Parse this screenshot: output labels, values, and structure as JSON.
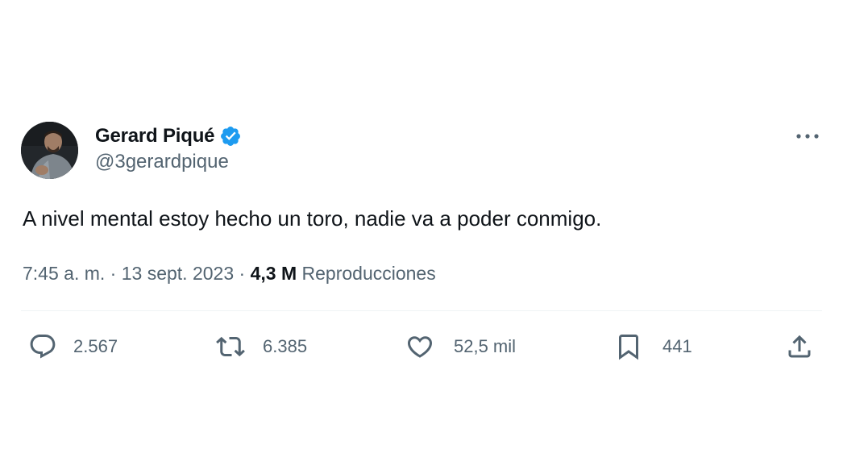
{
  "tweet": {
    "author": {
      "display_name": "Gerard Piqué",
      "handle": "@3gerardpique",
      "verified": true
    },
    "text": "A nivel mental estoy hecho un toro, nadie va a poder conmigo.",
    "meta": {
      "time": "7:45 a. m.",
      "separator": " · ",
      "date": "13 sept. 2023",
      "views_count": "4,3 M",
      "views_label": "Reproducciones"
    },
    "actions": {
      "replies": "2.567",
      "reposts": "6.385",
      "likes": "52,5 mil",
      "bookmarks": "441"
    }
  },
  "colors": {
    "text_primary": "#0f1419",
    "text_secondary": "#536471",
    "verified_blue": "#1d9bf0",
    "divider": "#eff3f4"
  },
  "icons": {
    "more": "more-horizontal-icon",
    "verified": "verified-badge-icon",
    "reply": "reply-bubble-icon",
    "repost": "repost-arrows-icon",
    "like": "heart-icon",
    "bookmark": "bookmark-icon",
    "share": "share-upload-icon"
  }
}
